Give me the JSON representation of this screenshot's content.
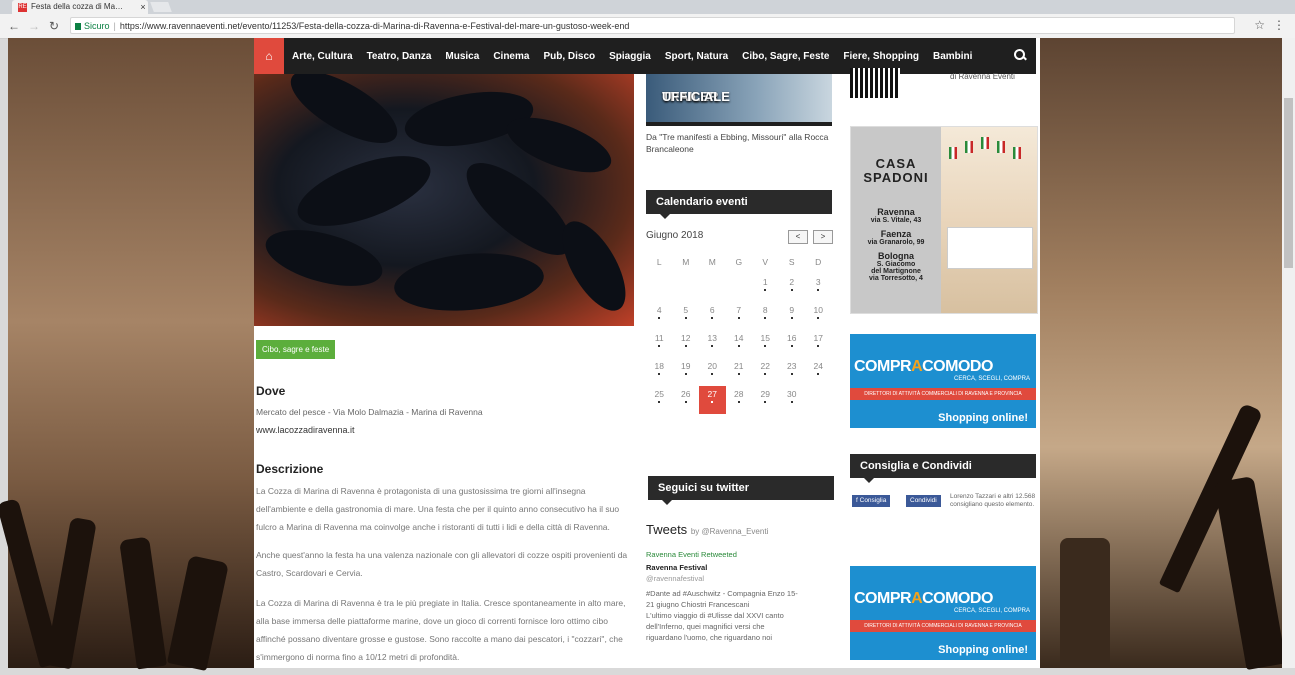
{
  "browser": {
    "tab_title": "Festa della cozza di Ma…",
    "tab_close": "×",
    "secure_label": "Sicuro",
    "address_separator": "|",
    "url": "https://www.ravennaeventi.net/evento/11253/Festa-della-cozza-di-Marina-di-Ravenna-e-Festival-del-mare-un-gustoso-week-end",
    "icons": [
      "back-icon",
      "forward-icon",
      "reload-icon",
      "lock-icon",
      "star-icon",
      "menu-icon"
    ]
  },
  "nav": {
    "items": [
      "Arte, Cultura",
      "Teatro, Danza",
      "Musica",
      "Cinema",
      "Pub, Disco",
      "Spiaggia",
      "Sport, Natura",
      "Cibo, Sagre, Feste",
      "Fiere, Shopping",
      "Bambini"
    ]
  },
  "event": {
    "category_tag": "Cibo, sagre e feste",
    "where_heading": "Dove",
    "where_address": "Mercato del pesce - Via Molo Dalmazia - Marina di Ravenna",
    "website": "www.lacozzadiravenna.it",
    "description_heading": "Descrizione",
    "description_1": "La Cozza di Marina di Ravenna è protagonista di una gustosissima tre giorni all'insegna dell'ambiente e della gastronomia di mare. Una festa che per il quinto anno consecutivo ha il suo fulcro a Marina di Ravenna ma coinvolge anche i ristoranti di tutti i lidi e della città di Ravenna.",
    "description_2": "Anche quest'anno la festa ha una valenza nazionale con gli allevatori di cozze ospiti provenienti da Castro, Scardovari e Cervia.",
    "description_3": "La Cozza di Marina di Ravenna è tra le più pregiate in Italia. Cresce spontaneamente in alto mare, alla base immersa delle piattaforme marine, dove un gioco di correnti fornisce loro ottimo cibo affinché possano diventare grosse e gustose. Sono raccolte a mano dai pescatori, i \"cozzari\", che s'immergono di norma fino a 10/12 metri di profondità."
  },
  "trailer": {
    "label_1": "TRAILER",
    "label_2": "UFFICIALE",
    "caption": "Da \"Tre manifesti a Ebbing, Missouri\" alla Rocca Brancaleone"
  },
  "calendar": {
    "heading": "Calendario eventi",
    "month": "Giugno 2018",
    "prev": "<",
    "next": ">",
    "weekdays": [
      "L",
      "M",
      "M",
      "G",
      "V",
      "S",
      "D"
    ],
    "today": "27",
    "weeks": [
      [
        "",
        "",
        "",
        "",
        "1",
        "2",
        "3"
      ],
      [
        "4",
        "5",
        "6",
        "7",
        "8",
        "9",
        "10"
      ],
      [
        "11",
        "12",
        "13",
        "14",
        "15",
        "16",
        "17"
      ],
      [
        "18",
        "19",
        "20",
        "21",
        "22",
        "23",
        "24"
      ],
      [
        "25",
        "26",
        "27",
        "28",
        "29",
        "30",
        ""
      ]
    ]
  },
  "twitter": {
    "heading": "Seguici su twitter",
    "title": "Tweets",
    "by": "by @Ravenna_Eventi",
    "retweet_label": "Ravenna Eventi Retweeted",
    "account_name": "Ravenna Festival",
    "account_handle": "@ravennafestival",
    "tweet_1": "#Dante ad #Auschwitz - Compagnia Enzo 15-",
    "tweet_2": "21 giugno Chiostri Francescani",
    "tweet_3": "L'ultimo viaggio di #Ulisse dal XXVI canto",
    "tweet_4": "dell'Inferno, quei magnifici versi che",
    "tweet_5": "riguardano l'uomo, che riguardano noi"
  },
  "sidebar": {
    "qr_caption": "di Ravenna Eventi",
    "casa": {
      "name_1": "CASA",
      "name_2": "SPADONI",
      "city_1": "Ravenna",
      "addr_1": "via S. Vitale, 43",
      "city_2": "Faenza",
      "addr_2": "via Granarolo, 99",
      "city_3": "Bologna",
      "addr_3a": "S. Giacomo",
      "addr_3b": "del Martignone",
      "addr_3c": "via Torresotto, 4"
    },
    "banner": {
      "logo_pre": "COMPR",
      "logo_o": "A",
      "logo_post": "COMODO",
      "subtitle": "CERCA, SCEGLI, COMPRA",
      "strip": "DIRETTORI DI ATTIVITÀ COMMERCIALI DI RAVENNA E PROVINCIA",
      "shop": "Shopping online!"
    },
    "share_heading": "Consiglia e Condividi",
    "like_button": "Consiglia",
    "share_button": "Condividi",
    "share_text": "Lorenzo Tazzari e altri 12.568 consigliano questo elemento."
  }
}
